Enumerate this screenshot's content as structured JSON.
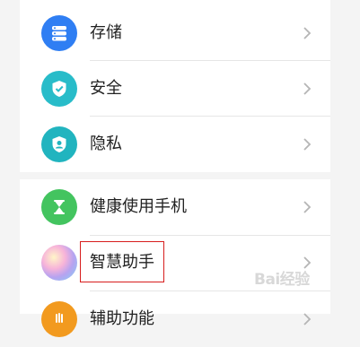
{
  "settings_list": {
    "top_group": [
      {
        "label": "存储",
        "icon": "storage-icon",
        "color": "#2f7ef3"
      },
      {
        "label": "安全",
        "icon": "shield-check-icon",
        "color": "#28bcc9"
      },
      {
        "label": "隐私",
        "icon": "privacy-shield-icon",
        "color": "#21b4bf"
      }
    ],
    "bottom_group": [
      {
        "label": "健康使用手机",
        "icon": "hourglass-icon",
        "color": "#43c45f"
      },
      {
        "label": "智慧助手",
        "icon": "smart-assistant-icon",
        "color": "#9ad0f0",
        "highlighted": true
      },
      {
        "label": "辅助功能",
        "icon": "accessibility-icon",
        "color": "#f29a1f"
      }
    ]
  },
  "highlight_color": "#d71d1d",
  "watermark": "Bai经验"
}
